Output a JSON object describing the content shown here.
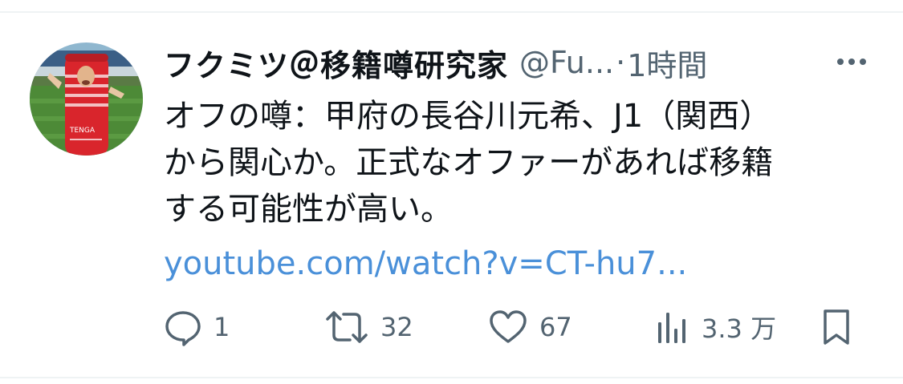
{
  "tweet": {
    "display_name": "フクミツ＠移籍噂研究家",
    "handle": "@Fu...",
    "separator": "·",
    "time": "1時間",
    "text_lines": [
      "オフの噂：甲府の長谷川元希、J1（関西）",
      "から関心か。正式なオファーがあれば移籍",
      "する可能性が高い。"
    ],
    "link": "youtube.com/watch?v=CT-hu7..."
  },
  "avatar": {
    "product_text": "TENGA"
  },
  "actions": {
    "reply_count": "1",
    "retweet_count": "32",
    "like_count": "67",
    "views_count": "3.3 万"
  },
  "colors": {
    "text": "#0f1419",
    "secondary": "#536471",
    "link": "#4a90d9",
    "divider": "#eff3f4"
  },
  "icons": [
    "more-icon",
    "reply-icon",
    "retweet-icon",
    "like-icon",
    "views-icon",
    "bookmark-icon"
  ]
}
